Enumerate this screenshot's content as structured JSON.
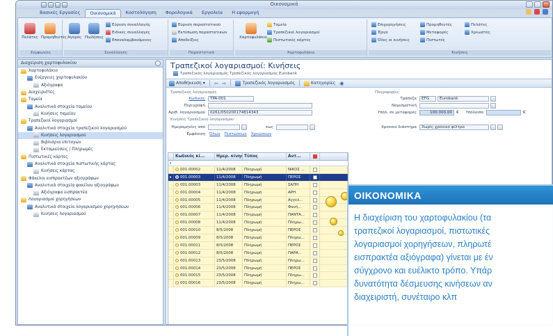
{
  "window": {
    "title": "Οικονομικά"
  },
  "app_logo": "Gt",
  "ribbon_tabs": [
    "Βασικές Εργασίες",
    "Οικονομικά",
    "Κοστολόγηση",
    "Φορολογικά",
    "Εργαλεία",
    "Η εφαρμογή"
  ],
  "ribbon": {
    "groups": [
      {
        "label": "Συμφωνίες",
        "buttons": [
          "Πελάτες",
          "Προμηθευτές"
        ]
      },
      {
        "label": "Συναλλαγές",
        "buttons": [
          "Αγορές",
          "Πωλήσεις"
        ],
        "small": [
          "Εύρεση συναλλαγής",
          "Ειδικές συναλλαγές",
          "Επαναλαμβανόμενες"
        ]
      },
      {
        "label": "Παραστατικά",
        "small": [
          "Εύρεση παραστατικού",
          "Εκτύπωση παραστατικών",
          "Αποδείξεις"
        ]
      },
      {
        "label": "Χαρτοφυλάκιο",
        "buttons": [
          "Χαρτοφυλάκιο"
        ],
        "small": [
          "Ταμεία",
          "Τραπεζικοί λογαριασμοί",
          "Πιστωτικές κάρτες"
        ]
      },
      {
        "label": "Κινήσεις",
        "small": [
          "Επιχορηγήσεις",
          "Έργα",
          "Όλες οι κινήσεις",
          "Προμηθευτές",
          "Μεταφορές",
          "Πιστωτές",
          "Πελάτες",
          "Χρεωστές"
        ]
      }
    ]
  },
  "nav": {
    "header": "Διαχείριση χαρτοφυλακίου",
    "items": [
      {
        "label": "Χαρτοφυλάκιο",
        "level": 0,
        "icon": "folder-icon"
      },
      {
        "label": "Ενέργειες χαρτοφυλακίου",
        "level": 1,
        "icon": "list-icon"
      },
      {
        "label": "Αξιόγραφα",
        "level": 2,
        "icon": "document-icon"
      },
      {
        "label": "Διαχειριστές",
        "level": 0,
        "icon": "users-icon"
      },
      {
        "label": "Ταμεία",
        "level": 0,
        "icon": "cash-icon"
      },
      {
        "label": "Αναλυτικά στοιχεία ταμείου",
        "level": 1,
        "icon": "detail-icon"
      },
      {
        "label": "Κινήσεις ταμείου",
        "level": 2,
        "icon": "grid-icon"
      },
      {
        "label": "Τραπεζικοί λογαριασμοί",
        "level": 0,
        "icon": "bank-icon"
      },
      {
        "label": "Αναλυτικά στοιχεία τραπεζικού λογαριασμού",
        "level": 1,
        "icon": "detail-icon"
      },
      {
        "label": "Κινήσεις λογαριασμού",
        "level": 2,
        "icon": "grid-icon",
        "selected": true
      },
      {
        "label": "Βιβλιάρια επιταγών",
        "level": 2,
        "icon": "book-icon"
      },
      {
        "label": "Εκταμιεύσεις / Πληρωμές",
        "level": 2,
        "icon": "payment-icon"
      },
      {
        "label": "Πιστωτικές κάρτες",
        "level": 0,
        "icon": "card-icon"
      },
      {
        "label": "Αναλυτικά στοιχεία πιστωτικής κάρτας",
        "level": 1,
        "icon": "detail-icon"
      },
      {
        "label": "Κινήσεις κάρτας",
        "level": 2,
        "icon": "grid-icon"
      },
      {
        "label": "Φάκελοι εισπρακτέων αξιογράφων",
        "level": 0,
        "icon": "folder-icon"
      },
      {
        "label": "Αναλυτικά στοιχεία φακέλου αξιογράφων",
        "level": 1,
        "icon": "detail-icon"
      },
      {
        "label": "Αξιόγραφα εισπρακτέα",
        "level": 2,
        "icon": "document-icon"
      },
      {
        "label": "Λογαριασμοί χορηγήσεων",
        "level": 0,
        "icon": "loan-icon"
      },
      {
        "label": "Αναλυτικά στοιχεία λογαριασμού χορηγήσεων",
        "level": 1,
        "icon": "detail-icon"
      },
      {
        "label": "Κινήσεις λογαριασμού",
        "level": 2,
        "icon": "grid-icon"
      }
    ]
  },
  "main": {
    "title": "Τραπεζικοί λογαριασμοί: Κινήσεις",
    "breadcrumb": "Τραπεζικός λογαριασμός Τραπεζικός λογαριασμός Eurobank",
    "toolbar": {
      "save": "Αποθήκευση",
      "bank_account": "Τραπεζικός λογαριασμός",
      "categories": "Κατηγορίες"
    },
    "form": {
      "section_account": "Τραπεζικός λογαριασμός",
      "section_details": "Πληροφορίες",
      "section_movements": "Κινήσεις Τραπεζικού λογαριασμού",
      "code_label": "Κωδικός",
      "code_value": "TPA-001",
      "desc_label": "Περιγραφή",
      "desc_value": "",
      "accno_label": "Αριθ. λογαριασμού",
      "accno_value": "0261/050200174814343",
      "bank_label": "Τράπεζα",
      "bank_code": "EFG",
      "bank_name": "Eurobank",
      "currency_label": "Νομισματική",
      "currency_value": "",
      "limit_label": "Υπόλ. σε μεταφορές",
      "limit_value": "100.000,00",
      "balance_label": "Υπόλοιπο",
      "balance_value": "",
      "currency_symbol": "€",
      "date_from_label": "Ημερομηνίες από",
      "date_to_label": "έως",
      "period_label": "Χρονικό διάστημα",
      "period_value": "Χωρίς χρονικό φίλτρο",
      "display_label": "Εμφάνιση",
      "links": [
        "Όλων",
        "Πιστώσεων",
        "Χρεώσεων"
      ]
    },
    "grid": {
      "columns": [
        "",
        "Κωδικός κί...",
        "Ημερ. κίνησης",
        "Τύπος",
        "Αντ...",
        "",
        ""
      ],
      "rows": [
        {
          "code": "001.00002",
          "date": "11/4/2008",
          "type": "Πληρωμή",
          "party": "ΝΙΚΟΣ ..."
        },
        {
          "code": "001.00003",
          "date": "11/4/2008",
          "type": "Πληρωμή",
          "party": "ΠΕΡΟΣ",
          "selected": true
        },
        {
          "code": "001.00003",
          "date": "11/4/2008",
          "type": "Πληρωμή",
          "party": "ΣΑΠΗ"
        },
        {
          "code": "001.00004",
          "date": "11/4/2008",
          "type": "Πληρωμή",
          "party": "ΑΡΗ"
        },
        {
          "code": "001.00005",
          "date": "11/4/2008",
          "type": "Πληρωμή",
          "party": "Αγγελ..."
        },
        {
          "code": "001.00006",
          "date": "11/4/2008",
          "type": "Πληρωμή",
          "party": "Φανή..."
        },
        {
          "code": "001.00007",
          "date": "11/4/2008",
          "type": "Πληρωμή",
          "party": "ΠΑΝΤΑ..."
        },
        {
          "code": "001.00008",
          "date": "11/4/2008",
          "type": "Πληρωμή",
          "party": "Πληρω..."
        },
        {
          "code": "001.00010",
          "date": "8/5/2008",
          "type": "Πληρωμή",
          "party": "ΠΕΡΟΣ"
        },
        {
          "code": "001.00009",
          "date": "8/5/2008",
          "type": "Πληρωμή",
          "party": "Πληρω..."
        },
        {
          "code": "001.00011",
          "date": "8/5/2008",
          "type": "Πληρωμή",
          "party": "ΠΕΡΟΣ"
        },
        {
          "code": "001.00012",
          "date": "8/5/2008",
          "type": "Πληρωμή",
          "party": "ΠΑΡΑ..."
        },
        {
          "code": "001.00013",
          "date": "23/5/2008",
          "type": "Πληρωμή",
          "party": "Πληρω..."
        },
        {
          "code": "001.00014",
          "date": "23/5/2008",
          "type": "Πληρωμή",
          "party": "ΠΕΡΟΣ"
        },
        {
          "code": "001.00015",
          "date": "23/5/2008",
          "type": "Πληρωμή",
          "party": "Πληρω..."
        },
        {
          "code": "001.00016",
          "date": "23/5/2008",
          "type": "Πληρωμή",
          "party": "Πληρω..."
        }
      ]
    }
  },
  "overlay": {
    "heading": "ΟΙΚΟΝΟΜΙΚΑ",
    "lines": [
      "Η διαχείριση του χαρτοφυλακίου (τα",
      "τραπεζικοί λογαριασμοί, πιστωτικές",
      "λογαριασμοί χορηγήσεων, πληρωτέ",
      "εισπρακτέα αξιόγραφα) γίνεται με έν",
      "σύγχρονο και ευέλικτο τρόπο. Υπάρ",
      "δυνατότητα δέσμευσης κινήσεων αν",
      "διαχειριστή, συνέταιρο κλπ"
    ]
  },
  "colors": {
    "accent": "#1f73b9",
    "overlay_text": "#2a7fc4",
    "grid_row": "#fff8cf",
    "grid_selected": "#1d3d8c"
  }
}
